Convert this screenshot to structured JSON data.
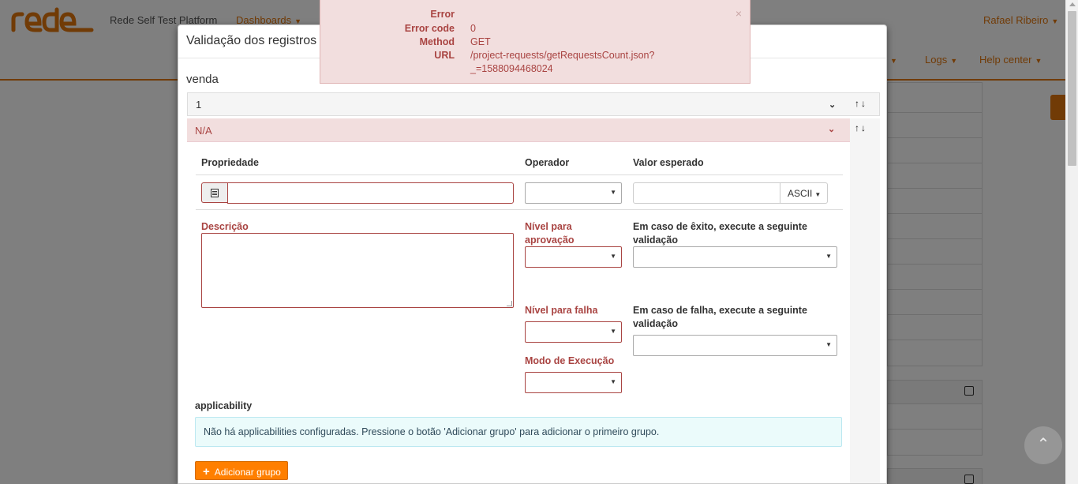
{
  "navbar": {
    "brand": "Rede Self Test Platform",
    "dashboards": "Dashboards",
    "user": "Rafael Ribeiro",
    "logs": "Logs",
    "help": "Help center"
  },
  "modal": {
    "title": "Validação dos registros d",
    "section": "venda",
    "panel1_label": "1",
    "panel2_label": "N/A",
    "columns": {
      "property": "Propriedade",
      "operator": "Operador",
      "expected": "Valor esperado"
    },
    "ascii_label": "ASCII",
    "description_label": "Descrição",
    "approval_level": "Nível para aprovação",
    "success_action": "Em caso de êxito, execute a seguinte validação",
    "fail_level": "Nível para falha",
    "fail_action": "Em caso de falha, execute a seguinte validação",
    "execution_mode": "Modo de Execução",
    "applicability_label": "applicability",
    "applicability_empty": "Não há applicabilities configuradas. Pressione o botão 'Adicionar grupo' para adicionar o primeiro grupo.",
    "add_group_button": "Adicionar grupo"
  },
  "error_toast": {
    "title_key": "Error",
    "code_key": "Error code",
    "code_value": "0",
    "method_key": "Method",
    "method_value": "GET",
    "url_key": "URL",
    "url_value": "/project-requests/getRequestsCount.json?_=1588094468024",
    "close": "×"
  },
  "colors": {
    "brand": "#e3760d",
    "error": "#a94442",
    "error_bg": "#f2dede",
    "button": "#ff7f00",
    "info_bg": "#ebfbfb"
  },
  "icons": [
    "list-icon",
    "chevron-down-icon",
    "arrow-up-icon",
    "arrow-down-icon",
    "plus-icon",
    "edit-icon",
    "close-icon",
    "caret-down-icon",
    "scroll-top-icon"
  ]
}
